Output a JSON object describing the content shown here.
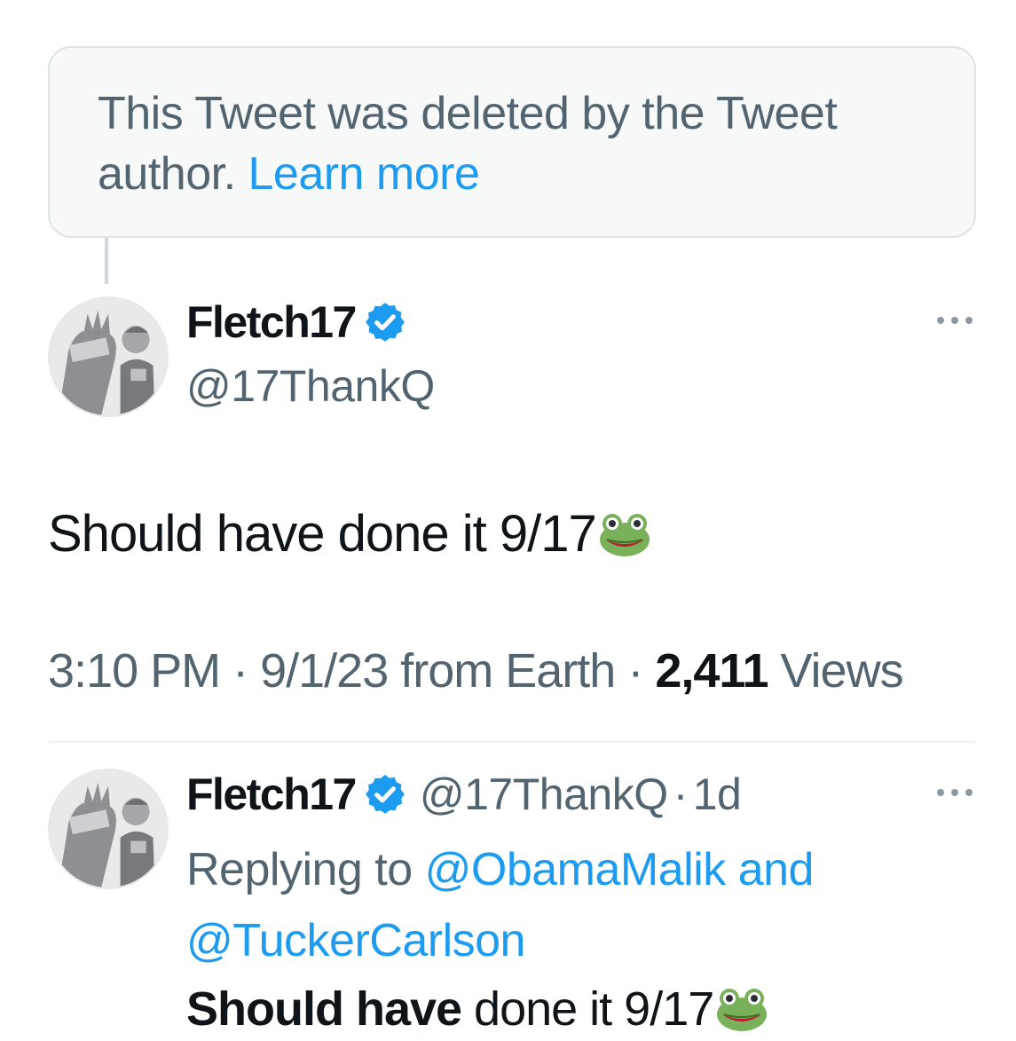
{
  "deleted_notice": {
    "text": "This Tweet was deleted by the Tweet author.",
    "link": "Learn more"
  },
  "main_tweet": {
    "display_name": "Fletch17",
    "handle": "@17ThankQ",
    "text": "Should have done it 9/17",
    "emoji": "frog-face",
    "time": "3:10 PM",
    "date": "9/1/23",
    "source": "from Earth",
    "views_count": "2,411",
    "views_label": "Views"
  },
  "reply_tweet": {
    "display_name": "Fletch17",
    "handle": "@17ThankQ",
    "separator": "·",
    "age": "1d",
    "replying_prefix": "Replying to",
    "mention_1": "@ObamaMalik",
    "conjunction": "and",
    "mention_2": "@TuckerCarlson",
    "text_bold": "Should have",
    "text_rest": "done it 9/17",
    "emoji": "frog-face"
  },
  "icons": {
    "verified": "verified-badge-icon",
    "more": "more-horizontal-icon"
  },
  "colors": {
    "link": "#1d9bf0",
    "secondary_text": "#536471",
    "primary_text": "#0f1419"
  }
}
